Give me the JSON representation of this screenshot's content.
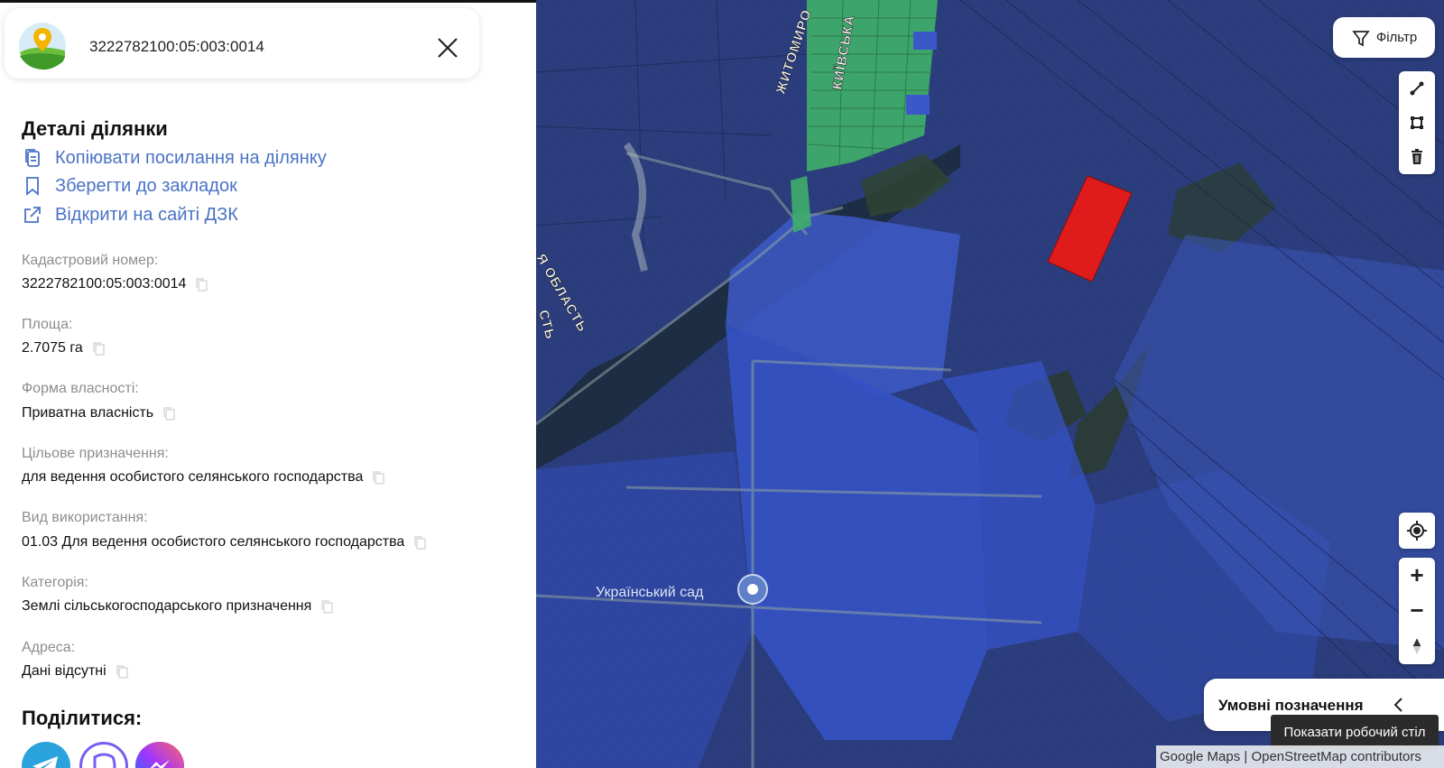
{
  "search": {
    "value": "3222782100:05:003:0014"
  },
  "details": {
    "title": "Деталі ділянки",
    "actions": [
      {
        "label": "Копіювати посилання на ділянку",
        "icon": "copy-icon"
      },
      {
        "label": "Зберегти до закладок",
        "icon": "bookmark-icon"
      },
      {
        "label": "Відкрити на сайті ДЗК",
        "icon": "external-link-icon"
      }
    ],
    "fields": [
      {
        "label": "Кадастровий номер:",
        "value": "3222782100:05:003:0014"
      },
      {
        "label": "Площа:",
        "value": "2.7075 га"
      },
      {
        "label": "Форма власності:",
        "value": "Приватна власність"
      },
      {
        "label": "Цільове призначення:",
        "value": "для ведення особистого селянського господарства"
      },
      {
        "label": "Вид використання:",
        "value": "01.03 Для ведення особистого селянського господарства"
      },
      {
        "label": "Категорія:",
        "value": "Землі сільськогосподарського призначення"
      },
      {
        "label": "Адреса:",
        "value": "Дані відсутні"
      }
    ],
    "share_title": "Поділитися:",
    "share": [
      {
        "name": "telegram",
        "color": "#2aa3dd"
      },
      {
        "name": "viber",
        "color": "#7360f2"
      },
      {
        "name": "messenger",
        "color": "#a334fa"
      }
    ]
  },
  "map": {
    "labels": {
      "road_top": "ЖИТОМИРО",
      "road_top2": "КИЇВСЬКА",
      "oblast": "Я ОБЛАСТЬ",
      "oblast2": "СТЬ",
      "poi": "Український сад"
    },
    "filter_label": "Фільтр",
    "legend_label": "Умовні позначення",
    "tooltip": "Показати робочий стіл",
    "attribution": {
      "google": "Google Maps",
      "separator": " | ",
      "osm": "OpenStreetMap contributors"
    },
    "zoom_in": "+",
    "zoom_out": "−",
    "colors": {
      "parcel_fill": "#3a5ad0",
      "selected_parcel": "#e01b1b",
      "green_parcels": "#3fae6a"
    }
  }
}
